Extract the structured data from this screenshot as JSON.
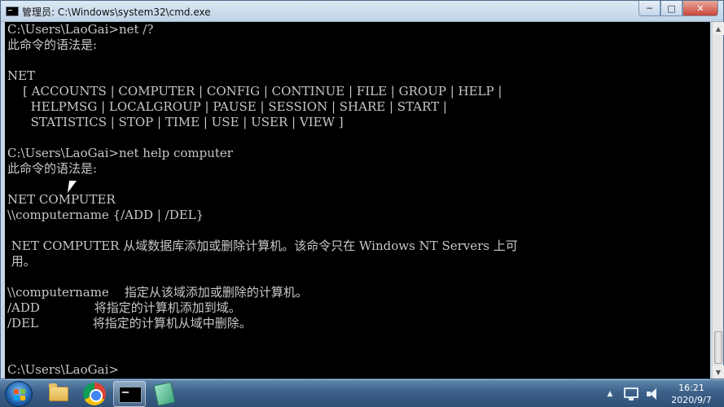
{
  "window": {
    "title": "管理员: C:\\Windows\\system32\\cmd.exe",
    "controls": {
      "minimize": "─",
      "maximize": "□",
      "close": "✕"
    }
  },
  "console": {
    "lines": [
      "C:\\Users\\LaoGai>net /?",
      "此命令的语法是:",
      "",
      "NET",
      "    [ ACCOUNTS | COMPUTER | CONFIG | CONTINUE | FILE | GROUP | HELP |",
      "      HELPMSG | LOCALGROUP | PAUSE | SESSION | SHARE | START |",
      "      STATISTICS | STOP | TIME | USE | USER | VIEW ]",
      "",
      "C:\\Users\\LaoGai>net help computer",
      "此命令的语法是:",
      "",
      "NET COMPUTER",
      "\\\\computername {/ADD | /DEL}",
      "",
      " NET COMPUTER 从域数据库添加或删除计算机。该命令只在 Windows NT Servers 上可",
      " 用。",
      "",
      "\\\\computername    指定从该域添加或删除的计算机。",
      "/ADD              将指定的计算机添加到域。",
      "/DEL              将指定的计算机从域中删除。",
      "",
      "",
      "C:\\Users\\LaoGai>"
    ]
  },
  "scrollbar": {
    "up_arrow": "▲",
    "down_arrow": "▼"
  },
  "taskbar": {
    "tray_arrow": "▲",
    "clock": {
      "time": "16:21",
      "date": "2020/9/7"
    }
  },
  "colors": {
    "console_background": "#000000",
    "console_text": "#c8c8c8",
    "taskbar": "#3c6088"
  }
}
